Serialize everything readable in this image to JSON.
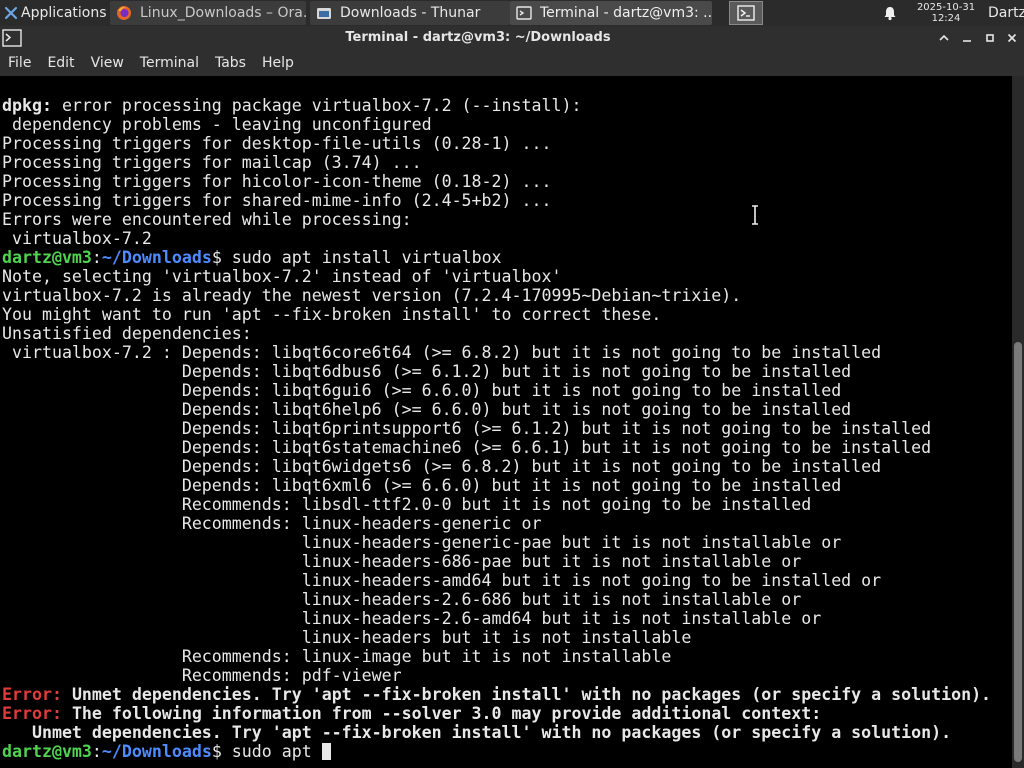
{
  "panel": {
    "applications_label": "Applications",
    "tasks": [
      {
        "label": "Linux_Downloads – Ora..."
      },
      {
        "label": "Downloads - Thunar"
      },
      {
        "label": "Terminal - dartz@vm3: ..."
      }
    ],
    "clock_date": "2025-10-31",
    "clock_time": "12:24",
    "user": "Dartz"
  },
  "window": {
    "title": "Terminal - dartz@vm3: ~/Downloads"
  },
  "menu": [
    "File",
    "Edit",
    "View",
    "Terminal",
    "Tabs",
    "Help"
  ],
  "colors": {
    "prompt_user": "#4fd44f",
    "prompt_path": "#4d8cff",
    "error": "#e03b3b"
  },
  "terminal": {
    "lines": [
      "dpkg: error processing package virtualbox-7.2 (--install):",
      " dependency problems - leaving unconfigured",
      "Processing triggers for desktop-file-utils (0.28-1) ...",
      "Processing triggers for mailcap (3.74) ...",
      "Processing triggers for hicolor-icon-theme (0.18-2) ...",
      "Processing triggers for shared-mime-info (2.4-5+b2) ...",
      "Errors were encountered while processing:",
      " virtualbox-7.2",
      "dartz@vm3:~/Downloads$ sudo apt install virtualbox",
      "Note, selecting 'virtualbox-7.2' instead of 'virtualbox'",
      "virtualbox-7.2 is already the newest version (7.2.4-170995~Debian~trixie).",
      "You might want to run 'apt --fix-broken install' to correct these.",
      "Unsatisfied dependencies:",
      " virtualbox-7.2 : Depends: libqt6core6t64 (>= 6.8.2) but it is not going to be installed",
      "                  Depends: libqt6dbus6 (>= 6.1.2) but it is not going to be installed",
      "                  Depends: libqt6gui6 (>= 6.6.0) but it is not going to be installed",
      "                  Depends: libqt6help6 (>= 6.6.0) but it is not going to be installed",
      "                  Depends: libqt6printsupport6 (>= 6.1.2) but it is not going to be installed",
      "                  Depends: libqt6statemachine6 (>= 6.6.1) but it is not going to be installed",
      "                  Depends: libqt6widgets6 (>= 6.8.2) but it is not going to be installed",
      "                  Depends: libqt6xml6 (>= 6.6.0) but it is not going to be installed",
      "                  Recommends: libsdl-ttf2.0-0 but it is not going to be installed",
      "                  Recommends: linux-headers-generic or",
      "                              linux-headers-generic-pae but it is not installable or",
      "                              linux-headers-686-pae but it is not installable or",
      "                              linux-headers-amd64 but it is not going to be installed or",
      "                              linux-headers-2.6-686 but it is not installable or",
      "                              linux-headers-2.6-amd64 but it is not installable or",
      "                              linux-headers but it is not installable",
      "                  Recommends: linux-image but it is not installable",
      "                  Recommends: pdf-viewer",
      "Error: Unmet dependencies. Try 'apt --fix-broken install' with no packages (or specify a solution).",
      "Error: The following information from --solver 3.0 may provide additional context:",
      "   Unmet dependencies. Try 'apt --fix-broken install' with no packages (or specify a solution).",
      "dartz@vm3:~/Downloads$ sudo apt "
    ]
  }
}
